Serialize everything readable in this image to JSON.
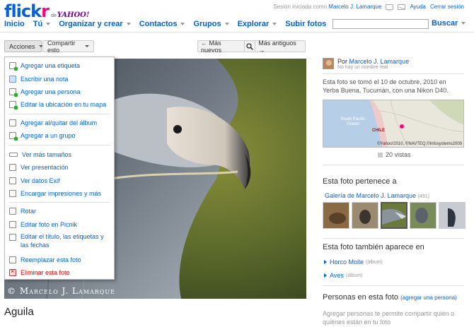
{
  "header": {
    "logo_main": "flickr",
    "logo_de": "de",
    "logo_yahoo": "YAHOO!",
    "session_prefix": "Sesión iniciada como",
    "session_user": "Marcelo J. Lamarque",
    "help": "Ayuda",
    "logout": "Cerrar sesión",
    "icons": [
      "cart-icon",
      "mail-icon"
    ]
  },
  "nav": {
    "items": [
      "Inicio",
      "Tú",
      "Organizar y crear",
      "Contactos",
      "Grupos",
      "Explorar",
      "Subir fotos"
    ],
    "search_placeholder": "",
    "search_label": "Buscar"
  },
  "toolbar": {
    "acciones": "Acciones",
    "compartir": "Compartir esto",
    "newer": "← Más nuevos",
    "older": "Más antiguos →"
  },
  "menu": {
    "items": [
      "Agregar una etiqueta",
      "Escribir una nota",
      "Agregar una persona",
      "Editar la ubicación en tu mapa",
      "Agregar al/quitar del álbum",
      "Agregar a un grupo",
      "Ver más tamaños",
      "Ver presentación",
      "Ver datos Exif",
      "Encargar impresiones y más",
      "Rotar",
      "Editar foto en Picnik",
      "Editar el título, las etiquetas y las fechas",
      "Reemplazar esta foto",
      "Eliminar esta foto"
    ]
  },
  "photo": {
    "watermark": "© Marcelo J. Lamarque",
    "title": "Aguila"
  },
  "sidebar": {
    "by_prefix": "Por",
    "owner": "Marcelo J. Lamarque",
    "real_name": "No hay un nombre real",
    "taken": "Esta foto se tomó el 10 de octubre, 2010 en Yerba Buena, Tucumán, con una Nikon D40.",
    "map_ocean": "South Pacific Ocean",
    "map_country": "CHILE",
    "map_copyright": "©Yahoo!2010, ©NAVTEQ,©Infosystems2009",
    "views": "20 vistas",
    "belongs_title": "Esta foto pertenece a",
    "gallery": "Galería de Marcelo J. Lamarque",
    "gallery_count": "(491)",
    "also_title": "Esta foto también aparece en",
    "groups": [
      {
        "name": "Horco Molle",
        "kind": "(álbum)"
      },
      {
        "name": "Aves",
        "kind": "(álbum)"
      }
    ],
    "people_title": "Personas en esta foto",
    "people_add": "(agregar una persona)",
    "people_text": "Agregar personas te permite compartir quién o quiénes están en tu foto"
  }
}
